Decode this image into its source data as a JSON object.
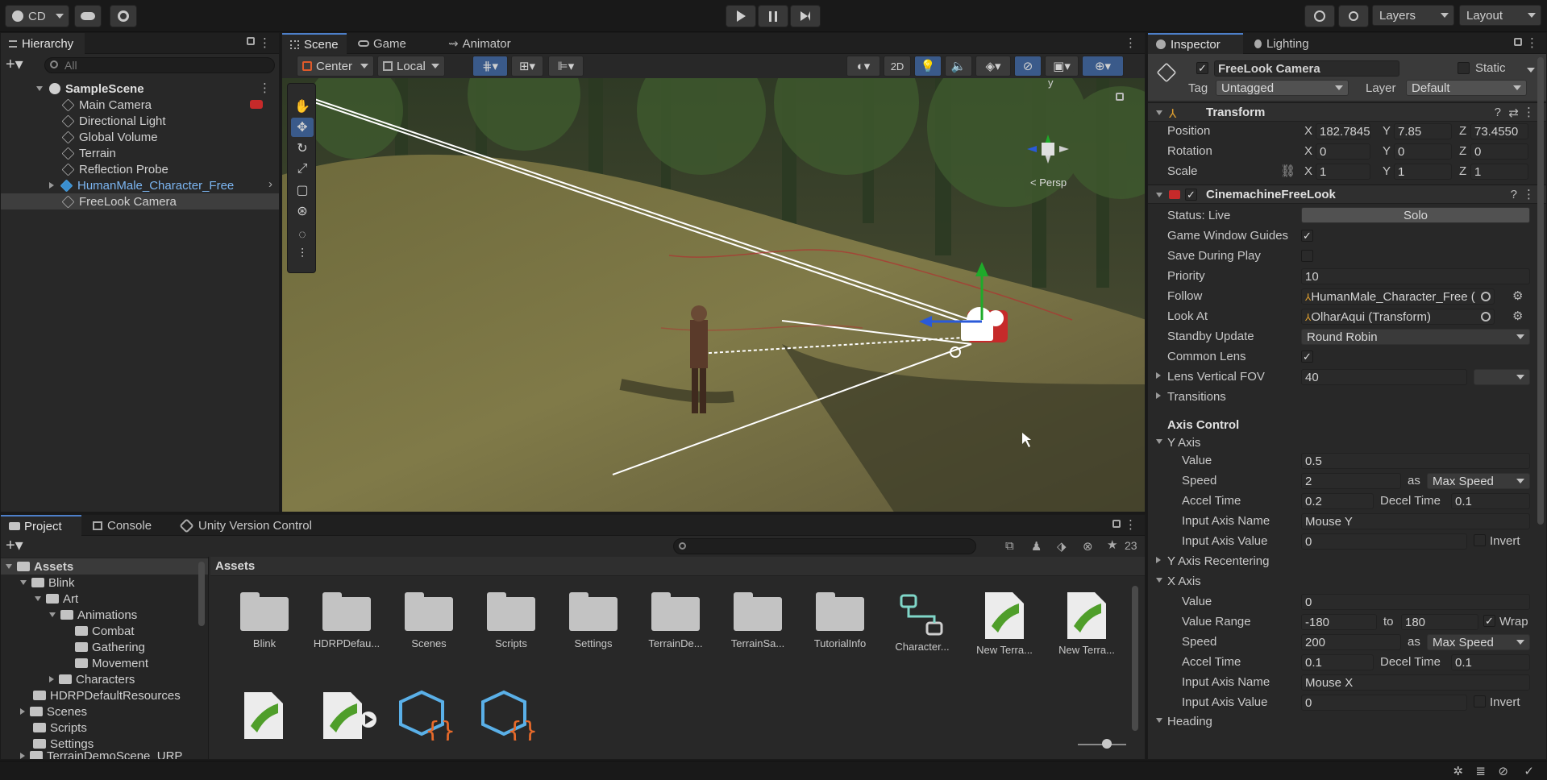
{
  "toolbar": {
    "account_label": "CD",
    "layers_label": "Layers",
    "layout_label": "Layout"
  },
  "hierarchy": {
    "tab_label": "Hierarchy",
    "search_placeholder": "All",
    "scene_name": "SampleScene",
    "items": [
      {
        "label": "Main Camera"
      },
      {
        "label": "Directional Light"
      },
      {
        "label": "Global Volume"
      },
      {
        "label": "Terrain"
      },
      {
        "label": "Reflection Probe"
      },
      {
        "label": "HumanMale_Character_Free"
      },
      {
        "label": "FreeLook Camera"
      }
    ]
  },
  "scene": {
    "tabs": [
      {
        "label": "Scene"
      },
      {
        "label": "Game"
      },
      {
        "label": "Animator"
      }
    ],
    "pivot_label": "Center",
    "space_label": "Local",
    "mode_2d_label": "2D",
    "gizmo_axis_y": "y",
    "persp_label": "< Persp"
  },
  "inspector": {
    "tabs": [
      {
        "label": "Inspector"
      },
      {
        "label": "Lighting"
      }
    ],
    "object_name": "FreeLook Camera",
    "static_label": "Static",
    "tag_label": "Tag",
    "tag_value": "Untagged",
    "layer_label": "Layer",
    "layer_value": "Default",
    "transform": {
      "title": "Transform",
      "position_label": "Position",
      "rotation_label": "Rotation",
      "scale_label": "Scale",
      "position": {
        "x": "182.7845",
        "y": "7.85",
        "z": "73.4550"
      },
      "rotation": {
        "x": "0",
        "y": "0",
        "z": "0"
      },
      "scale": {
        "x": "1",
        "y": "1",
        "z": "1"
      },
      "axis_x": "X",
      "axis_y": "Y",
      "axis_z": "Z"
    },
    "cinemachine": {
      "title": "CinemachineFreeLook",
      "status_label": "Status: Live",
      "solo_label": "Solo",
      "rows": [
        {
          "label": "Game Window Guides"
        },
        {
          "label": "Save During Play"
        },
        {
          "label": "Priority"
        },
        {
          "label": "Follow"
        },
        {
          "label": "Look At"
        },
        {
          "label": "Standby Update"
        },
        {
          "label": "Common Lens"
        },
        {
          "label": "Lens Vertical FOV"
        },
        {
          "label": "Transitions"
        }
      ],
      "priority_value": "10",
      "follow_value": "HumanMale_Character_Free (",
      "lookat_value": "OlharAqui (Transform)",
      "standby_value": "Round Robin",
      "fov_value": "40",
      "axis_control_label": "Axis Control",
      "y_axis": {
        "title": "Y Axis",
        "value_label": "Value",
        "value": "0.5",
        "speed_label": "Speed",
        "speed": "2",
        "as_label": "as",
        "speed_mode": "Max Speed",
        "accel_label": "Accel Time",
        "accel": "0.2",
        "decel_label": "Decel Time",
        "decel": "0.1",
        "input_name_label": "Input Axis Name",
        "input_name": "Mouse Y",
        "input_value_label": "Input Axis Value",
        "input_value": "0",
        "invert_label": "Invert"
      },
      "y_recentering_label": "Y Axis Recentering",
      "x_axis": {
        "title": "X Axis",
        "value_label": "Value",
        "value": "0",
        "range_label": "Value Range",
        "range_min": "-180",
        "to_label": "to",
        "range_max": "180",
        "wrap_label": "Wrap",
        "speed_label": "Speed",
        "speed": "200",
        "as_label": "as",
        "speed_mode": "Max Speed",
        "accel_label": "Accel Time",
        "accel": "0.1",
        "decel_label": "Decel Time",
        "decel": "0.1",
        "input_name_label": "Input Axis Name",
        "input_name": "Mouse X",
        "input_value_label": "Input Axis Value",
        "input_value": "0",
        "invert_label": "Invert"
      },
      "heading_label": "Heading"
    }
  },
  "project": {
    "tabs": [
      {
        "label": "Project"
      },
      {
        "label": "Console"
      },
      {
        "label": "Unity Version Control"
      }
    ],
    "hidden_count": "23",
    "breadcrumb": "Assets",
    "tree": [
      {
        "label": "Assets"
      },
      {
        "label": "Blink"
      },
      {
        "label": "Art"
      },
      {
        "label": "Animations"
      },
      {
        "label": "Combat"
      },
      {
        "label": "Gathering"
      },
      {
        "label": "Movement"
      },
      {
        "label": "Characters"
      },
      {
        "label": "HDRPDefaultResources"
      },
      {
        "label": "Scenes"
      },
      {
        "label": "Scripts"
      },
      {
        "label": "Settings"
      },
      {
        "label": "TerrainDemoScene_URP"
      }
    ],
    "assets": [
      {
        "label": "Blink"
      },
      {
        "label": "HDRPDefau..."
      },
      {
        "label": "Scenes"
      },
      {
        "label": "Scripts"
      },
      {
        "label": "Settings"
      },
      {
        "label": "TerrainDe..."
      },
      {
        "label": "TerrainSa..."
      },
      {
        "label": "TutorialInfo"
      },
      {
        "label": "Character..."
      },
      {
        "label": "New Terra..."
      },
      {
        "label": "New Terra..."
      }
    ]
  }
}
